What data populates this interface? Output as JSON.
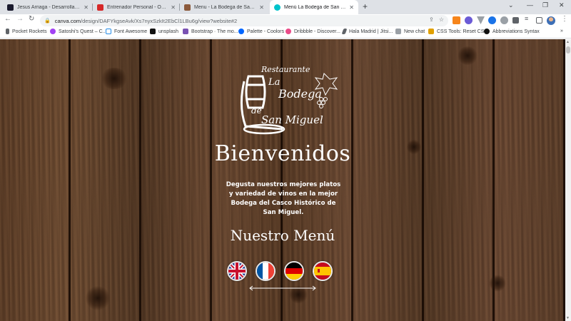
{
  "browser": {
    "tabs": [
      {
        "title": "Jesus Arriaga - Desarrollador Fro",
        "favicon_color": "#1a1a2e",
        "active": false
      },
      {
        "title": "Entrenador Personal - Online - Fit",
        "favicon_color": "#d62828",
        "active": false
      },
      {
        "title": "Menu - La Bodega de San Miguel",
        "favicon_color": "#8c5a3c",
        "active": false
      },
      {
        "title": "Menú La Bodega de San Miguel",
        "favicon_color": "#00c4cc",
        "active": true
      }
    ],
    "new_tab_icon": "plus-icon",
    "window_controls": [
      "v",
      "—",
      "❐",
      "✕"
    ],
    "url": {
      "host": "canva.com",
      "path": "/design/DAFYkgseAvk/Xs7nyxSzkIt2EbCl1LBu6g/view?website#2"
    }
  },
  "bookmarks": [
    {
      "label": "Pocket Rockets",
      "color": "#5f6368"
    },
    {
      "label": "Satoshi's Quest – C...",
      "color": "#a142f4"
    },
    {
      "label": "Font Awesome",
      "color": "#228be6"
    },
    {
      "label": "unsplash",
      "color": "#111111"
    },
    {
      "label": "Bootstrap · The mo...",
      "color": "#7952b3"
    },
    {
      "label": "Palette - Coolors",
      "color": "#0066ff"
    },
    {
      "label": "Dribbble - Discover...",
      "color": "#ea4c89"
    },
    {
      "label": "Hala Madrid | Jitsi...",
      "color": "#5f6368"
    },
    {
      "label": "New chat",
      "color": "#5f6368"
    },
    {
      "label": "CSS Tools: Reset CSS",
      "color": "#e0a000"
    },
    {
      "label": "Abbreviations Syntax",
      "color": "#111111"
    }
  ],
  "logo": {
    "small": "Restaurante",
    "line1": "La",
    "line2": "Bodega",
    "line3": "de",
    "line4": "San Miguel"
  },
  "page": {
    "welcome": "Bienvenidos",
    "tagline": "Degusta nuestros mejores platos y variedad de vinos en la mejor Bodega del Casco Histórico de San Miguel.",
    "menu_title": "Nuestro Menú",
    "flags": [
      "uk-flag-icon",
      "france-flag-icon",
      "germany-flag-icon",
      "spain-flag-icon"
    ]
  }
}
